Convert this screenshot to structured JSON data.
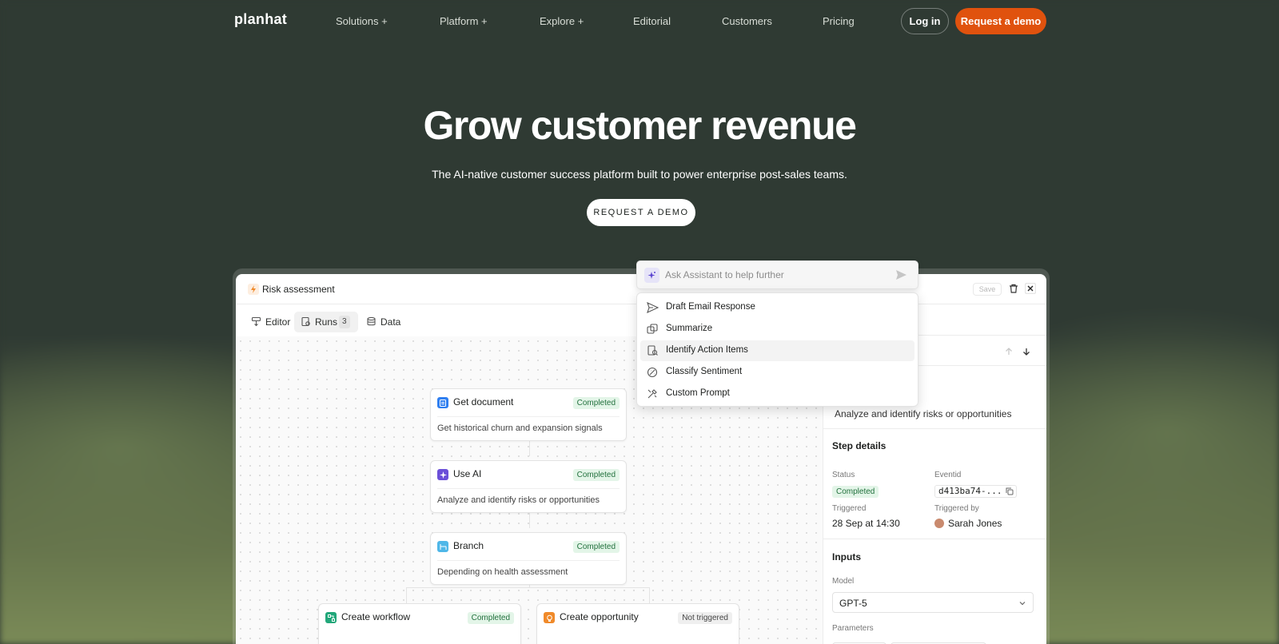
{
  "nav": {
    "logo": "planhat",
    "links": [
      "Solutions +",
      "Platform +",
      "Explore +",
      "Editorial",
      "Customers",
      "Pricing"
    ],
    "login": "Log in",
    "request_demo": "Request a demo"
  },
  "hero": {
    "title": "Grow customer revenue",
    "subtitle": "The AI-native customer success platform built to power enterprise post-sales teams.",
    "cta": "REQUEST A DEMO"
  },
  "app": {
    "title": "Risk assessment",
    "save_label": "Save",
    "tabs": [
      {
        "label": "Editor",
        "icon": "editor-icon"
      },
      {
        "label": "Runs",
        "icon": "runs-icon",
        "count": "3"
      },
      {
        "label": "Data",
        "icon": "database-icon"
      }
    ],
    "nodes": [
      {
        "title": "Get document",
        "status": "Completed",
        "desc": "Get historical churn and expansion signals",
        "icon": "document-icon",
        "color": "#2f7ff0"
      },
      {
        "title": "Use AI",
        "status": "Completed",
        "desc": "Analyze and identify risks or opportunities",
        "icon": "ai-icon",
        "color": "#6b4fd8"
      },
      {
        "title": "Branch",
        "status": "Completed",
        "desc": "Depending on health assessment",
        "icon": "branch-icon",
        "color": "#4fb7e8"
      },
      {
        "title": "Create workflow",
        "status": "Completed",
        "icon": "workflow-icon",
        "color": "#22a77a"
      },
      {
        "title": "Create opportunity",
        "status": "Not triggered",
        "icon": "opportunity-icon",
        "color": "#f08a2a"
      }
    ],
    "panel": {
      "description": "Analyze and identify risks or opportunities",
      "step_details_heading": "Step details",
      "status_label": "Status",
      "status_value": "Completed",
      "eventid_label": "Eventid",
      "eventid_value": "d413ba74-...",
      "triggered_label": "Triggered",
      "triggered_value": "28 Sep at 14:30",
      "triggered_by_label": "Triggered by",
      "triggered_by_value": "Sarah Jones",
      "inputs_heading": "Inputs",
      "model_label": "Model",
      "model_value": "GPT-5",
      "parameters_label": "Parameters"
    }
  },
  "assistant": {
    "placeholder": "Ask Assistant to help further",
    "items": [
      {
        "label": "Draft Email Response",
        "icon": "send-icon"
      },
      {
        "label": "Summarize",
        "icon": "summarize-icon"
      },
      {
        "label": "Identify Action Items",
        "icon": "search-document-icon"
      },
      {
        "label": "Classify Sentiment",
        "icon": "sentiment-icon"
      },
      {
        "label": "Custom Prompt",
        "icon": "tools-icon"
      }
    ]
  },
  "colors": {
    "background": "#2f3a33",
    "accent": "#e0520e",
    "completed_bg": "#e3f5e8",
    "completed_text": "#23713e"
  }
}
